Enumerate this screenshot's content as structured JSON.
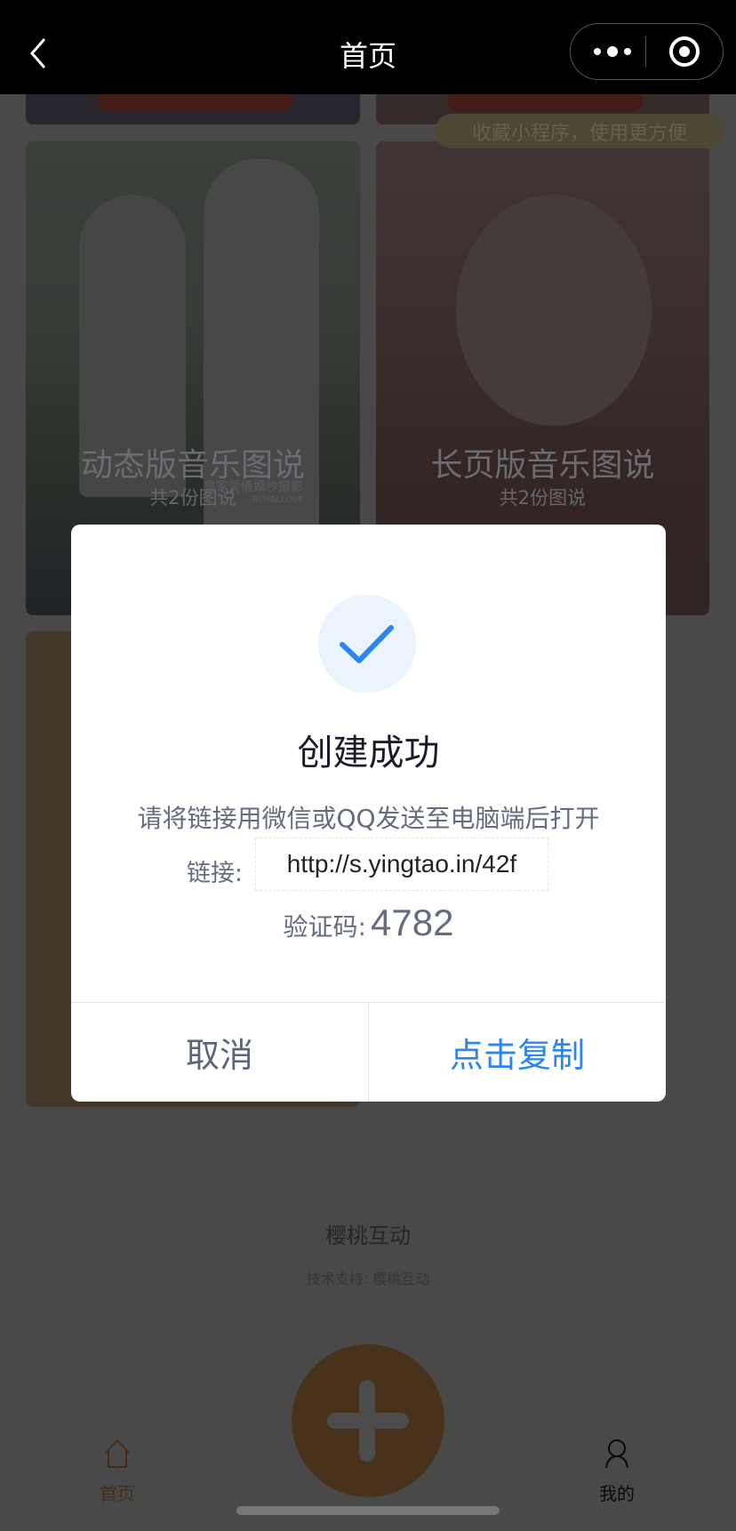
{
  "nav": {
    "title": "首页"
  },
  "tooltip": "收藏小程序，使用更方便",
  "cards": [
    {
      "title": "动态版音乐图说",
      "subtitle": "共2份图说",
      "overlay_lines": [
        "皇家爱情婚纱摄影",
        "ROYALLOVE"
      ]
    },
    {
      "title": "长页版音乐图说",
      "subtitle": "共2份图说"
    }
  ],
  "footer": {
    "brand": "樱桃互动",
    "support": "技术支持: 樱桃互动"
  },
  "tabbar": {
    "home": "首页",
    "mine": "我的"
  },
  "dialog": {
    "title": "创建成功",
    "message": "请将链接用微信或QQ发送至电脑端后打开",
    "link_label": "链接:",
    "link": "http://s.yingtao.in/42f",
    "code_label": "验证码:",
    "code": "4782",
    "cancel": "取消",
    "copy": "点击复制"
  },
  "colors": {
    "accent": "#2b86f0",
    "brand": "#e0a15a"
  }
}
